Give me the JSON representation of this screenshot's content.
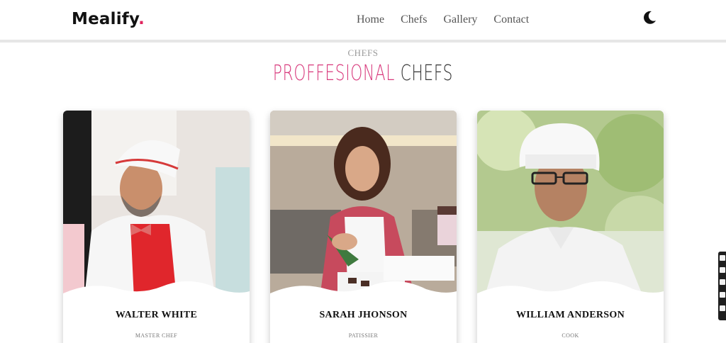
{
  "brand": {
    "name": "Mealify",
    "dot": ".",
    "accent": "#e0245e"
  },
  "nav": [
    {
      "label": "Home"
    },
    {
      "label": "Chefs"
    },
    {
      "label": "Gallery"
    },
    {
      "label": "Contact"
    }
  ],
  "theme_toggle_icon": "moon-icon",
  "section": {
    "subtitle": "CHEFS",
    "title_accent": "PROFFESIONAL",
    "title_rest": "CHEFS",
    "accent_color": "#d8397c"
  },
  "chefs": [
    {
      "name": "WALTER WHITE",
      "role": "MASTER CHEF"
    },
    {
      "name": "SARAH JHONSON",
      "role": "PATISSIER"
    },
    {
      "name": "WILLIAM ANDERSON",
      "role": "COOK"
    }
  ],
  "side_tools": [
    "link-icon",
    "camera-icon",
    "square-icon",
    "note-icon",
    "settings-icon"
  ]
}
